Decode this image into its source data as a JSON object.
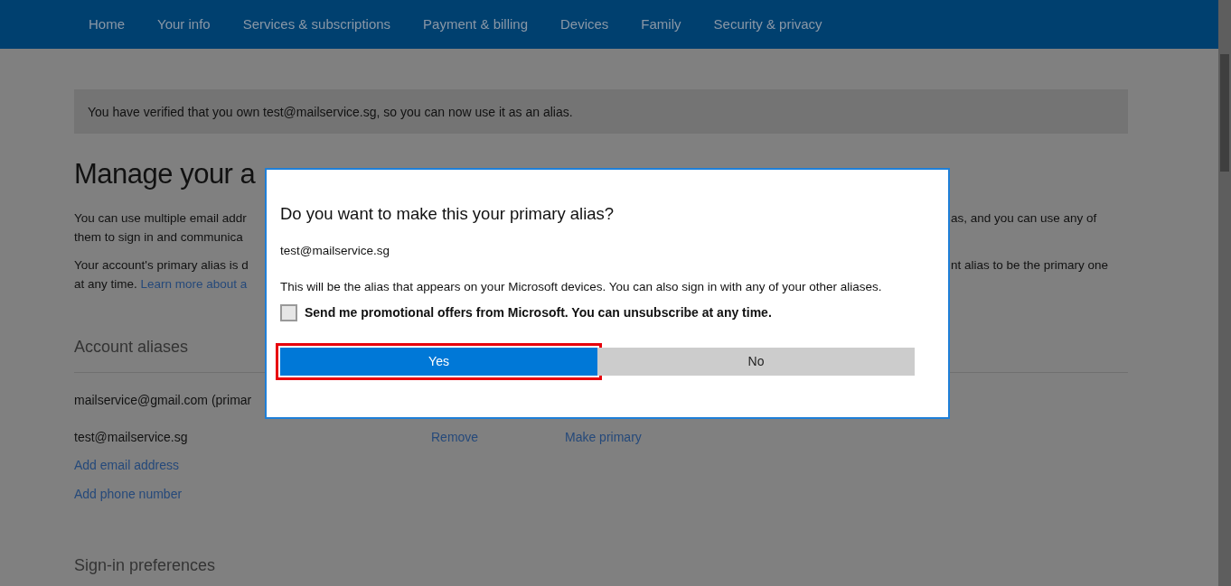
{
  "nav": {
    "items": [
      "Home",
      "Your info",
      "Services & subscriptions",
      "Payment & billing",
      "Devices",
      "Family",
      "Security & privacy"
    ]
  },
  "banner": {
    "text": "You have verified that you own test@mailservice.sg, so you can now use it as an alias."
  },
  "page": {
    "heading": "Manage your a",
    "paragraphs": [
      {
        "lines": [
          {
            "left": "You can use multiple email addr",
            "right": "as, and you can use any of"
          },
          {
            "left": "them to sign in and communica"
          }
        ]
      },
      {
        "lines": [
          {
            "left": "Your account's primary alias is d",
            "right": "nt alias to be the primary one"
          },
          {
            "left": "at any time.",
            "link": "Learn more about a"
          }
        ]
      }
    ]
  },
  "aliases": {
    "title": "Account aliases",
    "rows": [
      {
        "alias": "mailservice@gmail.com (primar"
      },
      {
        "alias": "test@mailservice.sg",
        "actions": [
          "Remove",
          "Make primary"
        ]
      }
    ],
    "links": [
      "Add email address",
      "Add phone number"
    ]
  },
  "sign_in": {
    "title": "Sign-in preferences"
  },
  "dialog": {
    "title": "Do you want to make this your primary alias?",
    "alias": "test@mailservice.sg",
    "message": "This will be the alias that appears on your Microsoft devices. You can also sign in with any of your other aliases.",
    "checkbox": {
      "label": "Send me promotional offers from Microsoft. You can unsubscribe at any time.",
      "checked": false
    },
    "buttons": [
      {
        "label": "Yes",
        "kind": "primary",
        "focused": true
      },
      {
        "label": "No",
        "kind": "secondary",
        "focused": false
      }
    ]
  }
}
